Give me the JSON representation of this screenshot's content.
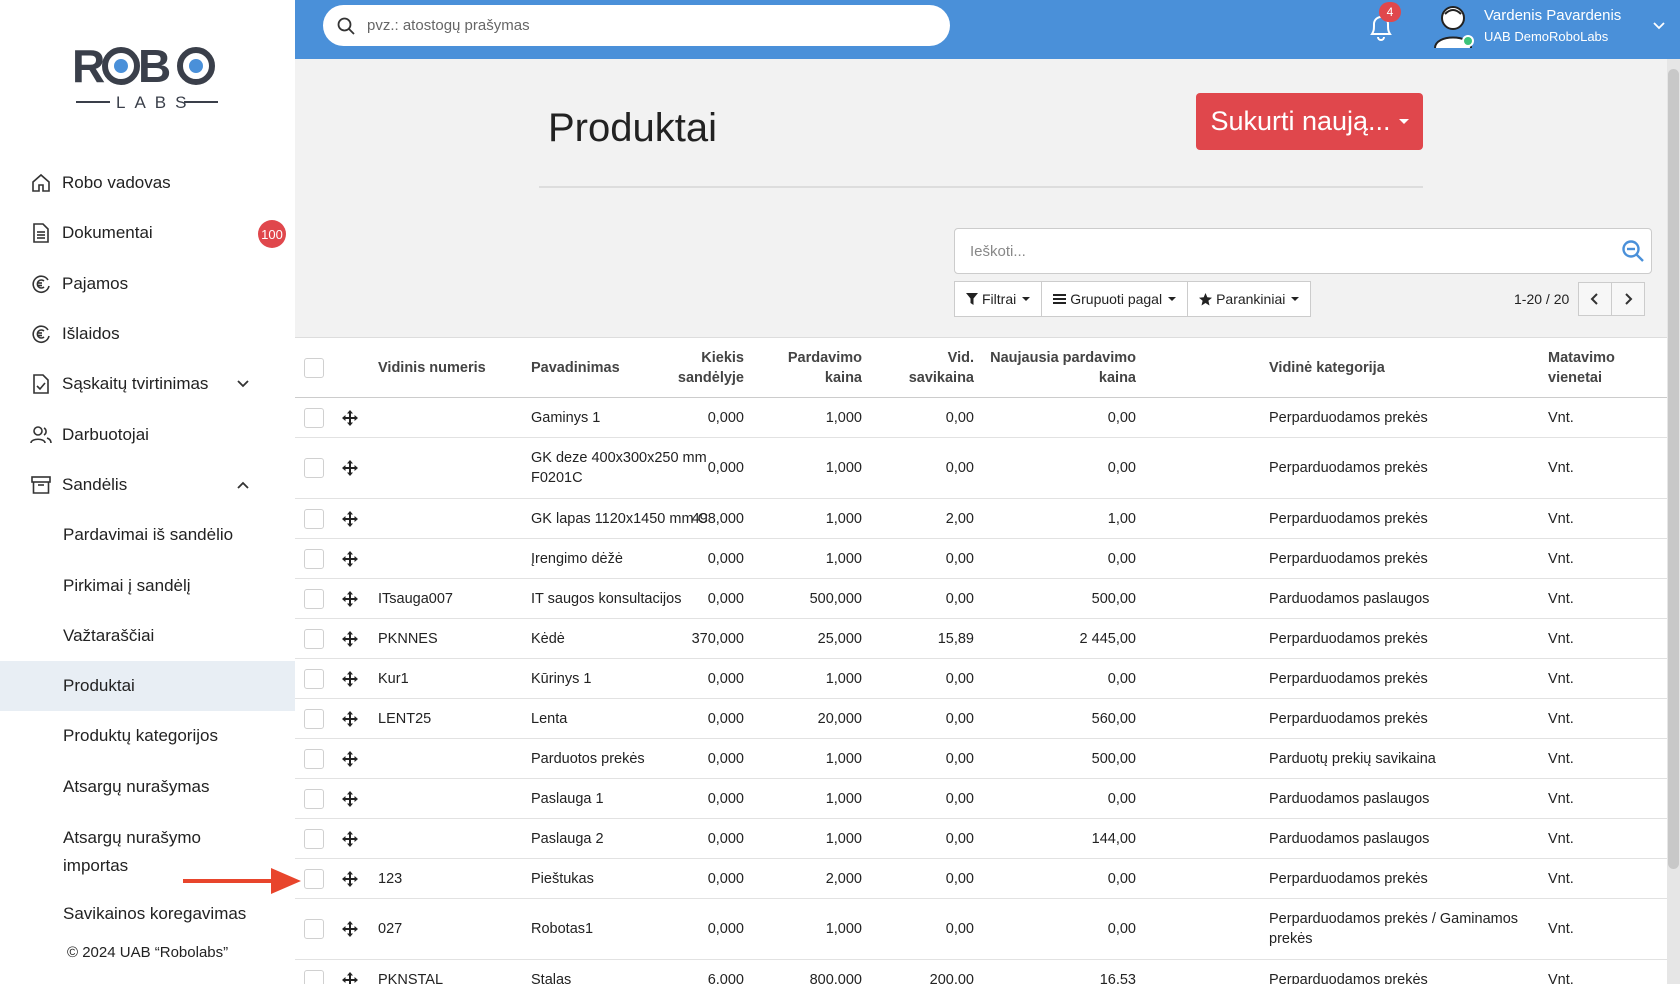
{
  "app": {
    "logo_text_top": "ROBO",
    "logo_text_bottom": "LABS",
    "copyright": "© 2024 UAB “Robolabs”"
  },
  "sidebar": {
    "items": [
      {
        "label": "Robo vadovas",
        "icon": "home-icon"
      },
      {
        "label": "Dokumentai",
        "icon": "document-icon",
        "badge": "100"
      },
      {
        "label": "Pajamos",
        "icon": "euro-income-icon"
      },
      {
        "label": "Išlaidos",
        "icon": "euro-expense-icon"
      },
      {
        "label": "Sąskaitų tvirtinimas",
        "icon": "file-check-icon",
        "expandable": true
      },
      {
        "label": "Darbuotojai",
        "icon": "users-icon"
      },
      {
        "label": "Sandėlis",
        "icon": "archive-icon",
        "expanded": true
      }
    ],
    "subitems": [
      {
        "label": "Pardavimai iš sandėlio"
      },
      {
        "label": "Pirkimai į sandėlį"
      },
      {
        "label": "Važtaraščiai"
      },
      {
        "label": "Produktai",
        "active": true
      },
      {
        "label": "Produktų kategorijos"
      },
      {
        "label": "Atsargų nurašymas"
      },
      {
        "label": "Atsargų nurašymo importas"
      },
      {
        "label": "Savikainos koregavimas"
      }
    ]
  },
  "topbar": {
    "search_placeholder": "pvz.: atostogų prašymas",
    "notifications_count": "4",
    "user_name": "Vardenis Pavardenis",
    "user_company": "UAB DemoRoboLabs",
    "accent_color": "#4a90d9"
  },
  "page": {
    "title": "Produktai",
    "create_button": "Sukurti naują...",
    "search_placeholder": "Ieškoti...",
    "filters_label": "Filtrai",
    "group_label": "Grupuoti pagal",
    "favorites_label": "Parankiniai",
    "pager_text": "1-20 / 20"
  },
  "table": {
    "headers": {
      "code": "Vidinis numeris",
      "name": "Pavadinimas",
      "qty": [
        "Kiekis",
        "sandėlyje"
      ],
      "price": [
        "Pardavimo",
        "kaina"
      ],
      "cost": [
        "Vid.",
        "savikaina"
      ],
      "last": [
        "Naujausia pardavimo",
        "kaina"
      ],
      "cat": "Vidinė kategorija",
      "unit": [
        "Matavimo",
        "vienetai"
      ]
    },
    "rows": [
      {
        "code": "",
        "name": "Gaminys 1",
        "qty": "0,000",
        "price": "1,000",
        "cost": "0,00",
        "last": "0,00",
        "cat": "Perparduodamos prekės",
        "unit": "Vnt."
      },
      {
        "code": "",
        "name": "GK deze 400x300x250 mm F0201C",
        "qty": "0,000",
        "price": "1,000",
        "cost": "0,00",
        "last": "0,00",
        "cat": "Perparduodamos prekės",
        "unit": "Vnt.",
        "tall": true
      },
      {
        "code": "",
        "name": "GK lapas 1120x1450 mm C",
        "qty": "498,000",
        "price": "1,000",
        "cost": "2,00",
        "last": "1,00",
        "cat": "Perparduodamos prekės",
        "unit": "Vnt."
      },
      {
        "code": "",
        "name": "Įrengimo dėžė",
        "qty": "0,000",
        "price": "1,000",
        "cost": "0,00",
        "last": "0,00",
        "cat": "Perparduodamos prekės",
        "unit": "Vnt."
      },
      {
        "code": "ITsauga007",
        "name": "IT saugos konsultacijos",
        "qty": "0,000",
        "price": "500,000",
        "cost": "0,00",
        "last": "500,00",
        "cat": "Parduodamos paslaugos",
        "unit": "Vnt."
      },
      {
        "code": "PKNNES",
        "name": "Kėdė",
        "qty": "370,000",
        "price": "25,000",
        "cost": "15,89",
        "last": "2 445,00",
        "cat": "Perparduodamos prekės",
        "unit": "Vnt."
      },
      {
        "code": "Kur1",
        "name": "Kūrinys 1",
        "qty": "0,000",
        "price": "1,000",
        "cost": "0,00",
        "last": "0,00",
        "cat": "Perparduodamos prekės",
        "unit": "Vnt."
      },
      {
        "code": "LENT25",
        "name": "Lenta",
        "qty": "0,000",
        "price": "20,000",
        "cost": "0,00",
        "last": "560,00",
        "cat": "Perparduodamos prekės",
        "unit": "Vnt."
      },
      {
        "code": "",
        "name": "Parduotos prekės",
        "qty": "0,000",
        "price": "1,000",
        "cost": "0,00",
        "last": "500,00",
        "cat": "Parduotų prekių savikaina",
        "unit": "Vnt."
      },
      {
        "code": "",
        "name": "Paslauga 1",
        "qty": "0,000",
        "price": "1,000",
        "cost": "0,00",
        "last": "0,00",
        "cat": "Parduodamos paslaugos",
        "unit": "Vnt."
      },
      {
        "code": "",
        "name": "Paslauga 2",
        "qty": "0,000",
        "price": "1,000",
        "cost": "0,00",
        "last": "144,00",
        "cat": "Parduodamos paslaugos",
        "unit": "Vnt."
      },
      {
        "code": "123",
        "name": "Pieštukas",
        "qty": "0,000",
        "price": "2,000",
        "cost": "0,00",
        "last": "0,00",
        "cat": "Perparduodamos prekės",
        "unit": "Vnt."
      },
      {
        "code": "027",
        "name": "Robotas1",
        "qty": "0,000",
        "price": "1,000",
        "cost": "0,00",
        "last": "0,00",
        "cat": "Perparduodamos prekės / Gaminamos prekės",
        "unit": "Vnt.",
        "tall": true
      },
      {
        "code": "PKNSTAL",
        "name": "Stalas",
        "qty": "6,000",
        "price": "800,000",
        "cost": "200,00",
        "last": "16,53",
        "cat": "Perparduodamos prekės",
        "unit": "Vnt."
      }
    ]
  }
}
